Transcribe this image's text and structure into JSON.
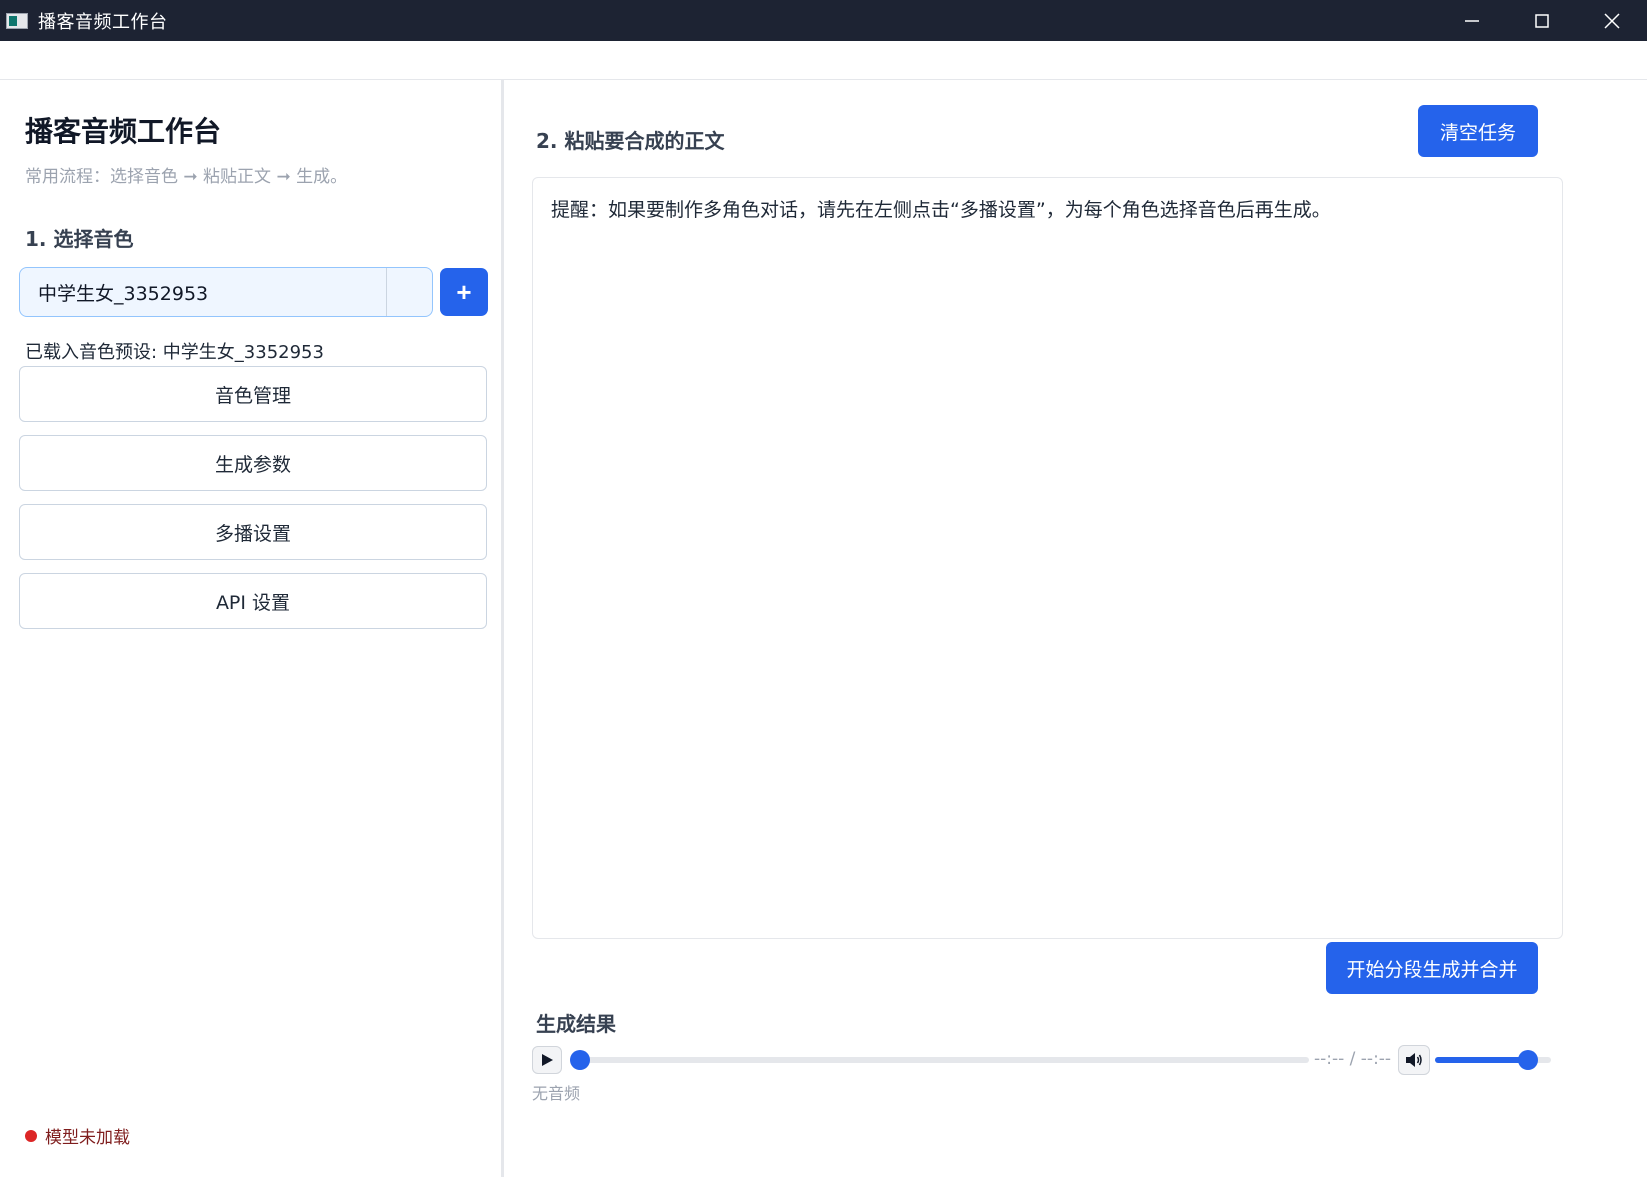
{
  "window": {
    "title": "播客音频工作台"
  },
  "sidebar": {
    "heading": "播客音频工作台",
    "subtitle": "常用流程：选择音色 ➞ 粘贴正文 ➞ 生成。",
    "section_label": "1. 选择音色",
    "voice_select": {
      "value": "中学生女_3352953"
    },
    "add_button_label": "+",
    "loaded_status": "已载入音色预设: 中学生女_3352953",
    "buttons": [
      {
        "label": "音色管理"
      },
      {
        "label": "生成参数"
      },
      {
        "label": "多播设置"
      },
      {
        "label": "API 设置"
      }
    ],
    "model_status": {
      "text": "模型未加载",
      "color": "#dc2626"
    }
  },
  "main": {
    "section_label": "2. 粘贴要合成的正文",
    "clear_button_label": "清空任务",
    "text_content": "提醒：如果要制作多角色对话，请先在左侧点击“多播设置”，为每个角色选择音色后再生成。",
    "generate_button_label": "开始分段生成并合并",
    "result_label": "生成结果",
    "player": {
      "time_display": "--:-- / --:--",
      "seek_progress": 0,
      "volume": 0.8,
      "status": "无音频"
    }
  },
  "colors": {
    "accent": "#2563eb",
    "titlebar": "#1d2333"
  }
}
